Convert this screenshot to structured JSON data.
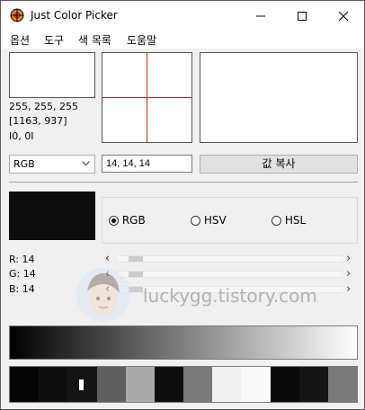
{
  "window": {
    "title": "Just Color Picker"
  },
  "menu": [
    "옵션",
    "도구",
    "색 목록",
    "도움말"
  ],
  "picked": {
    "rgb_text": "255, 255, 255",
    "coords_text": "[1163, 937]",
    "offset_text": "I0, 0I"
  },
  "format": {
    "selected": "RGB",
    "value": "14, 14, 14"
  },
  "copy_button": "값 복사",
  "current_color": "#0e0e0e",
  "modes": [
    {
      "label": "RGB",
      "checked": true
    },
    {
      "label": "HSV",
      "checked": false
    },
    {
      "label": "HSL",
      "checked": false
    }
  ],
  "channels": [
    {
      "label": "R: 14",
      "level": 0.055
    },
    {
      "label": "G: 14",
      "level": 0.055
    },
    {
      "label": "B: 14",
      "level": 0.055
    }
  ],
  "watermark": "luckygg.tistory.com",
  "history": [
    "#050505",
    "#0e0e0e",
    "#141414",
    "#5e5e5e",
    "#aaaaaa",
    "#0e0e0e",
    "#7a7a7a",
    "#f0f0f0",
    "#fafafa",
    "#0a0a0a",
    "#141414",
    "#7a7a7a"
  ],
  "icons": {
    "app": "color-picker-target-icon",
    "minimize": "minimize-icon",
    "maximize": "maximize-icon",
    "close": "close-icon"
  }
}
